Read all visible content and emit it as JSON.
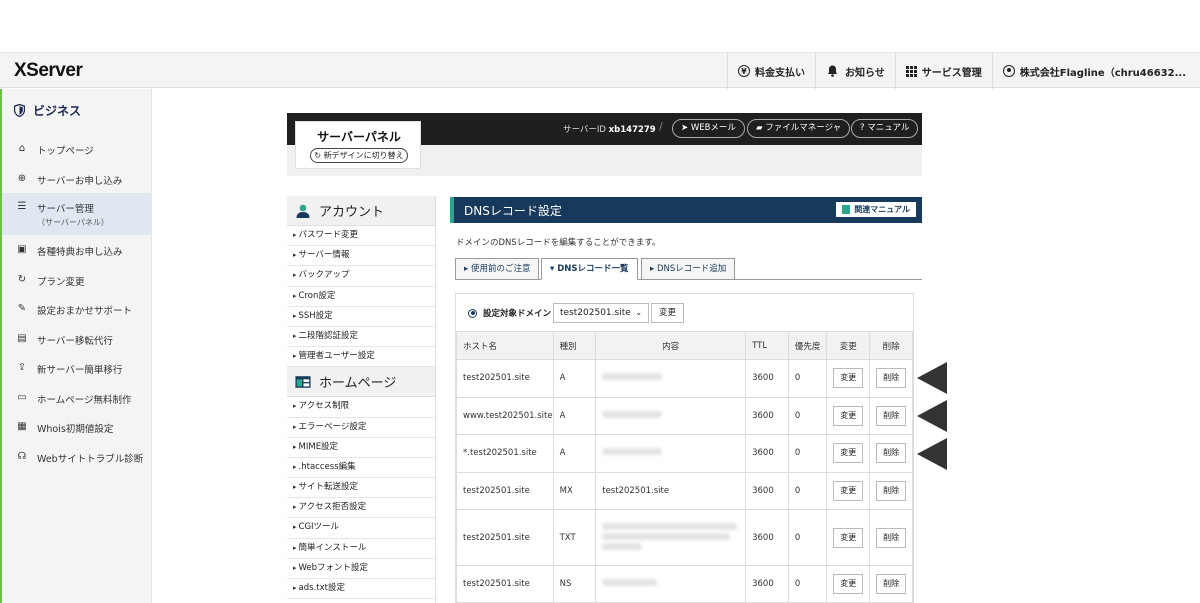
{
  "header": {
    "logo": "XServer",
    "nav": [
      {
        "label": "料金支払い",
        "icon": "yen-icon"
      },
      {
        "label": "お知らせ",
        "icon": "bell-icon"
      },
      {
        "label": "サービス管理",
        "icon": "grid-icon"
      },
      {
        "label": "株式会社Flagline（chru46632...",
        "icon": "user-icon"
      }
    ]
  },
  "sidebar": {
    "title": "ビジネス",
    "items": [
      {
        "label": "トップページ",
        "icon": "home-icon"
      },
      {
        "label": "サーバーお申し込み",
        "icon": "plus-circle-icon"
      },
      {
        "label": "サーバー管理",
        "sub": "（サーバーパネル）",
        "icon": "server-icon"
      },
      {
        "label": "各種特典お申し込み",
        "icon": "gift-icon"
      },
      {
        "label": "プラン変更",
        "icon": "refresh-icon"
      },
      {
        "label": "設定おまかせサポート",
        "icon": "wrench-icon"
      },
      {
        "label": "サーバー移転代行",
        "icon": "truck-icon"
      },
      {
        "label": "新サーバー簡単移行",
        "icon": "upload-icon"
      },
      {
        "label": "ホームページ無料制作",
        "icon": "window-icon"
      },
      {
        "label": "Whois初期値設定",
        "icon": "document-icon"
      },
      {
        "label": "Webサイトトラブル診断",
        "icon": "stethoscope-icon"
      }
    ]
  },
  "panel": {
    "title": "サーバーパネル",
    "switch_label": "新デザインに切り替え",
    "server_id_label": "サーバーID",
    "server_id": "xb147279",
    "separator": "/",
    "links": [
      "WEBメール",
      "ファイルマネージャ",
      "マニュアル"
    ]
  },
  "leftmenu": {
    "account_title": "アカウント",
    "account_items": [
      "パスワード変更",
      "サーバー情報",
      "バックアップ",
      "Cron設定",
      "SSH設定",
      "二段階認証設定",
      "管理者ユーザー設定"
    ],
    "homepage_title": "ホームページ",
    "homepage_items": [
      "アクセス制限",
      "エラーページ設定",
      "MIME設定",
      ".htaccess編集",
      "サイト転送設定",
      "アクセス拒否設定",
      "CGIツール",
      "簡単インストール",
      "Webフォント設定",
      "ads.txt設定"
    ]
  },
  "dns": {
    "title": "DNSレコード設定",
    "manual_label": "関連マニュアル",
    "description": "ドメインのDNSレコードを編集することができます。",
    "tabs": [
      "使用前のご注意",
      "DNSレコード一覧",
      "DNSレコード追加"
    ],
    "active_tab": 1,
    "domain_label": "設定対象ドメイン",
    "domain_value": "test202501.site",
    "domain_change": "変更",
    "columns": [
      "ホスト名",
      "種別",
      "内容",
      "TTL",
      "優先度",
      "変更",
      "削除"
    ],
    "rows": [
      {
        "host": "test202501.site",
        "type": "A",
        "content": "",
        "ttl": "3600",
        "priority": "0"
      },
      {
        "host": "www.test202501.site",
        "type": "A",
        "content": "",
        "ttl": "3600",
        "priority": "0"
      },
      {
        "host": "*.test202501.site",
        "type": "A",
        "content": "",
        "ttl": "3600",
        "priority": "0"
      },
      {
        "host": "test202501.site",
        "type": "MX",
        "content": "test202501.site",
        "ttl": "3600",
        "priority": "0"
      },
      {
        "host": "test202501.site",
        "type": "TXT",
        "content": "",
        "ttl": "3600",
        "priority": "0"
      },
      {
        "host": "test202501.site",
        "type": "NS",
        "content": "",
        "ttl": "3600",
        "priority": "0"
      }
    ],
    "edit_label": "変更",
    "delete_label": "削除"
  },
  "colors": {
    "navy": "#173a5c",
    "accent": "#2aa68f",
    "sidebar_accent": "#6cc04a"
  }
}
